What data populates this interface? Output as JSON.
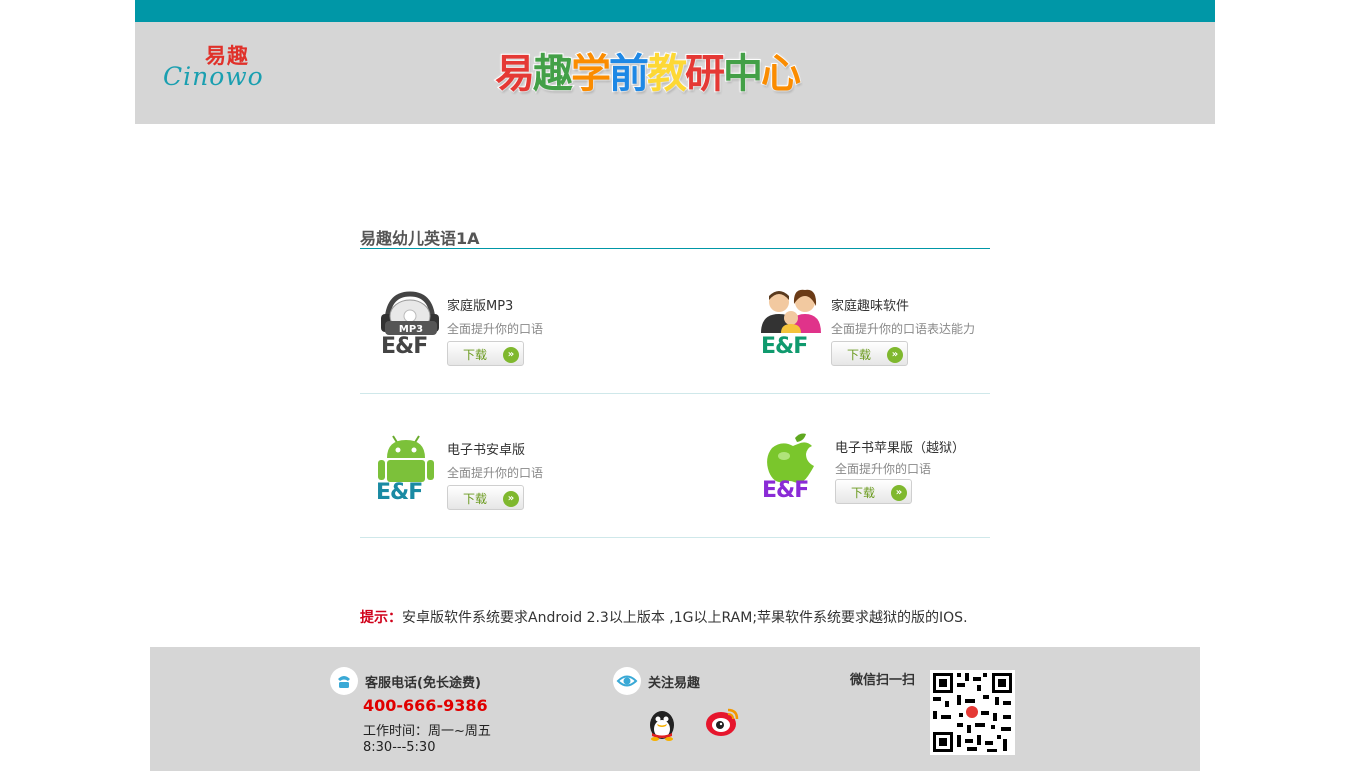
{
  "header": {
    "logo_cn": "易趣",
    "logo_en": "Cinowo",
    "banner_chars": [
      {
        "ch": "易",
        "color": "#e53935"
      },
      {
        "ch": "趣",
        "color": "#43a047"
      },
      {
        "ch": "学",
        "color": "#fb8c00"
      },
      {
        "ch": "前",
        "color": "#1e88e5"
      },
      {
        "ch": "教",
        "color": "#fdd835"
      },
      {
        "ch": "研",
        "color": "#e53935"
      },
      {
        "ch": "中",
        "color": "#43a047"
      },
      {
        "ch": "心",
        "color": "#fb8c00"
      }
    ]
  },
  "section": {
    "title": "易趣幼儿英语1A"
  },
  "products": {
    "mp3": {
      "name": "家庭版MP3",
      "desc": "全面提升你的口语",
      "download": "下载",
      "badge": "MP3",
      "brand": "E&F"
    },
    "software": {
      "name": "家庭趣味软件",
      "desc": "全面提升你的口语表达能力",
      "download": "下载",
      "brand": "E&F"
    },
    "android": {
      "name": "电子书安卓版",
      "desc": "全面提升你的口语",
      "download": "下载",
      "brand": "E&F"
    },
    "ios": {
      "name": "电子书苹果版（越狱）",
      "desc": "全面提升你的口语",
      "download": "下载",
      "brand": "E&F"
    }
  },
  "tip": {
    "label": "提示：",
    "text": "安卓版软件系统要求Android 2.3以上版本 ,1G以上RAM;苹果软件系统要求越狱的版的IOS."
  },
  "footer": {
    "service_title": "客服电话(免长途费)",
    "phone": "400-666-9386",
    "hours_label": "工作时间：周一~周五",
    "hours": "8:30---5:30",
    "follow_title": "关注易趣",
    "wechat_label": "微信扫一扫"
  },
  "colors": {
    "accent": "#0097a7",
    "header_bg": "#d6d6d6",
    "tip_red": "#d0021b",
    "phone_red": "#e00000",
    "download_green": "#7fb82e"
  }
}
